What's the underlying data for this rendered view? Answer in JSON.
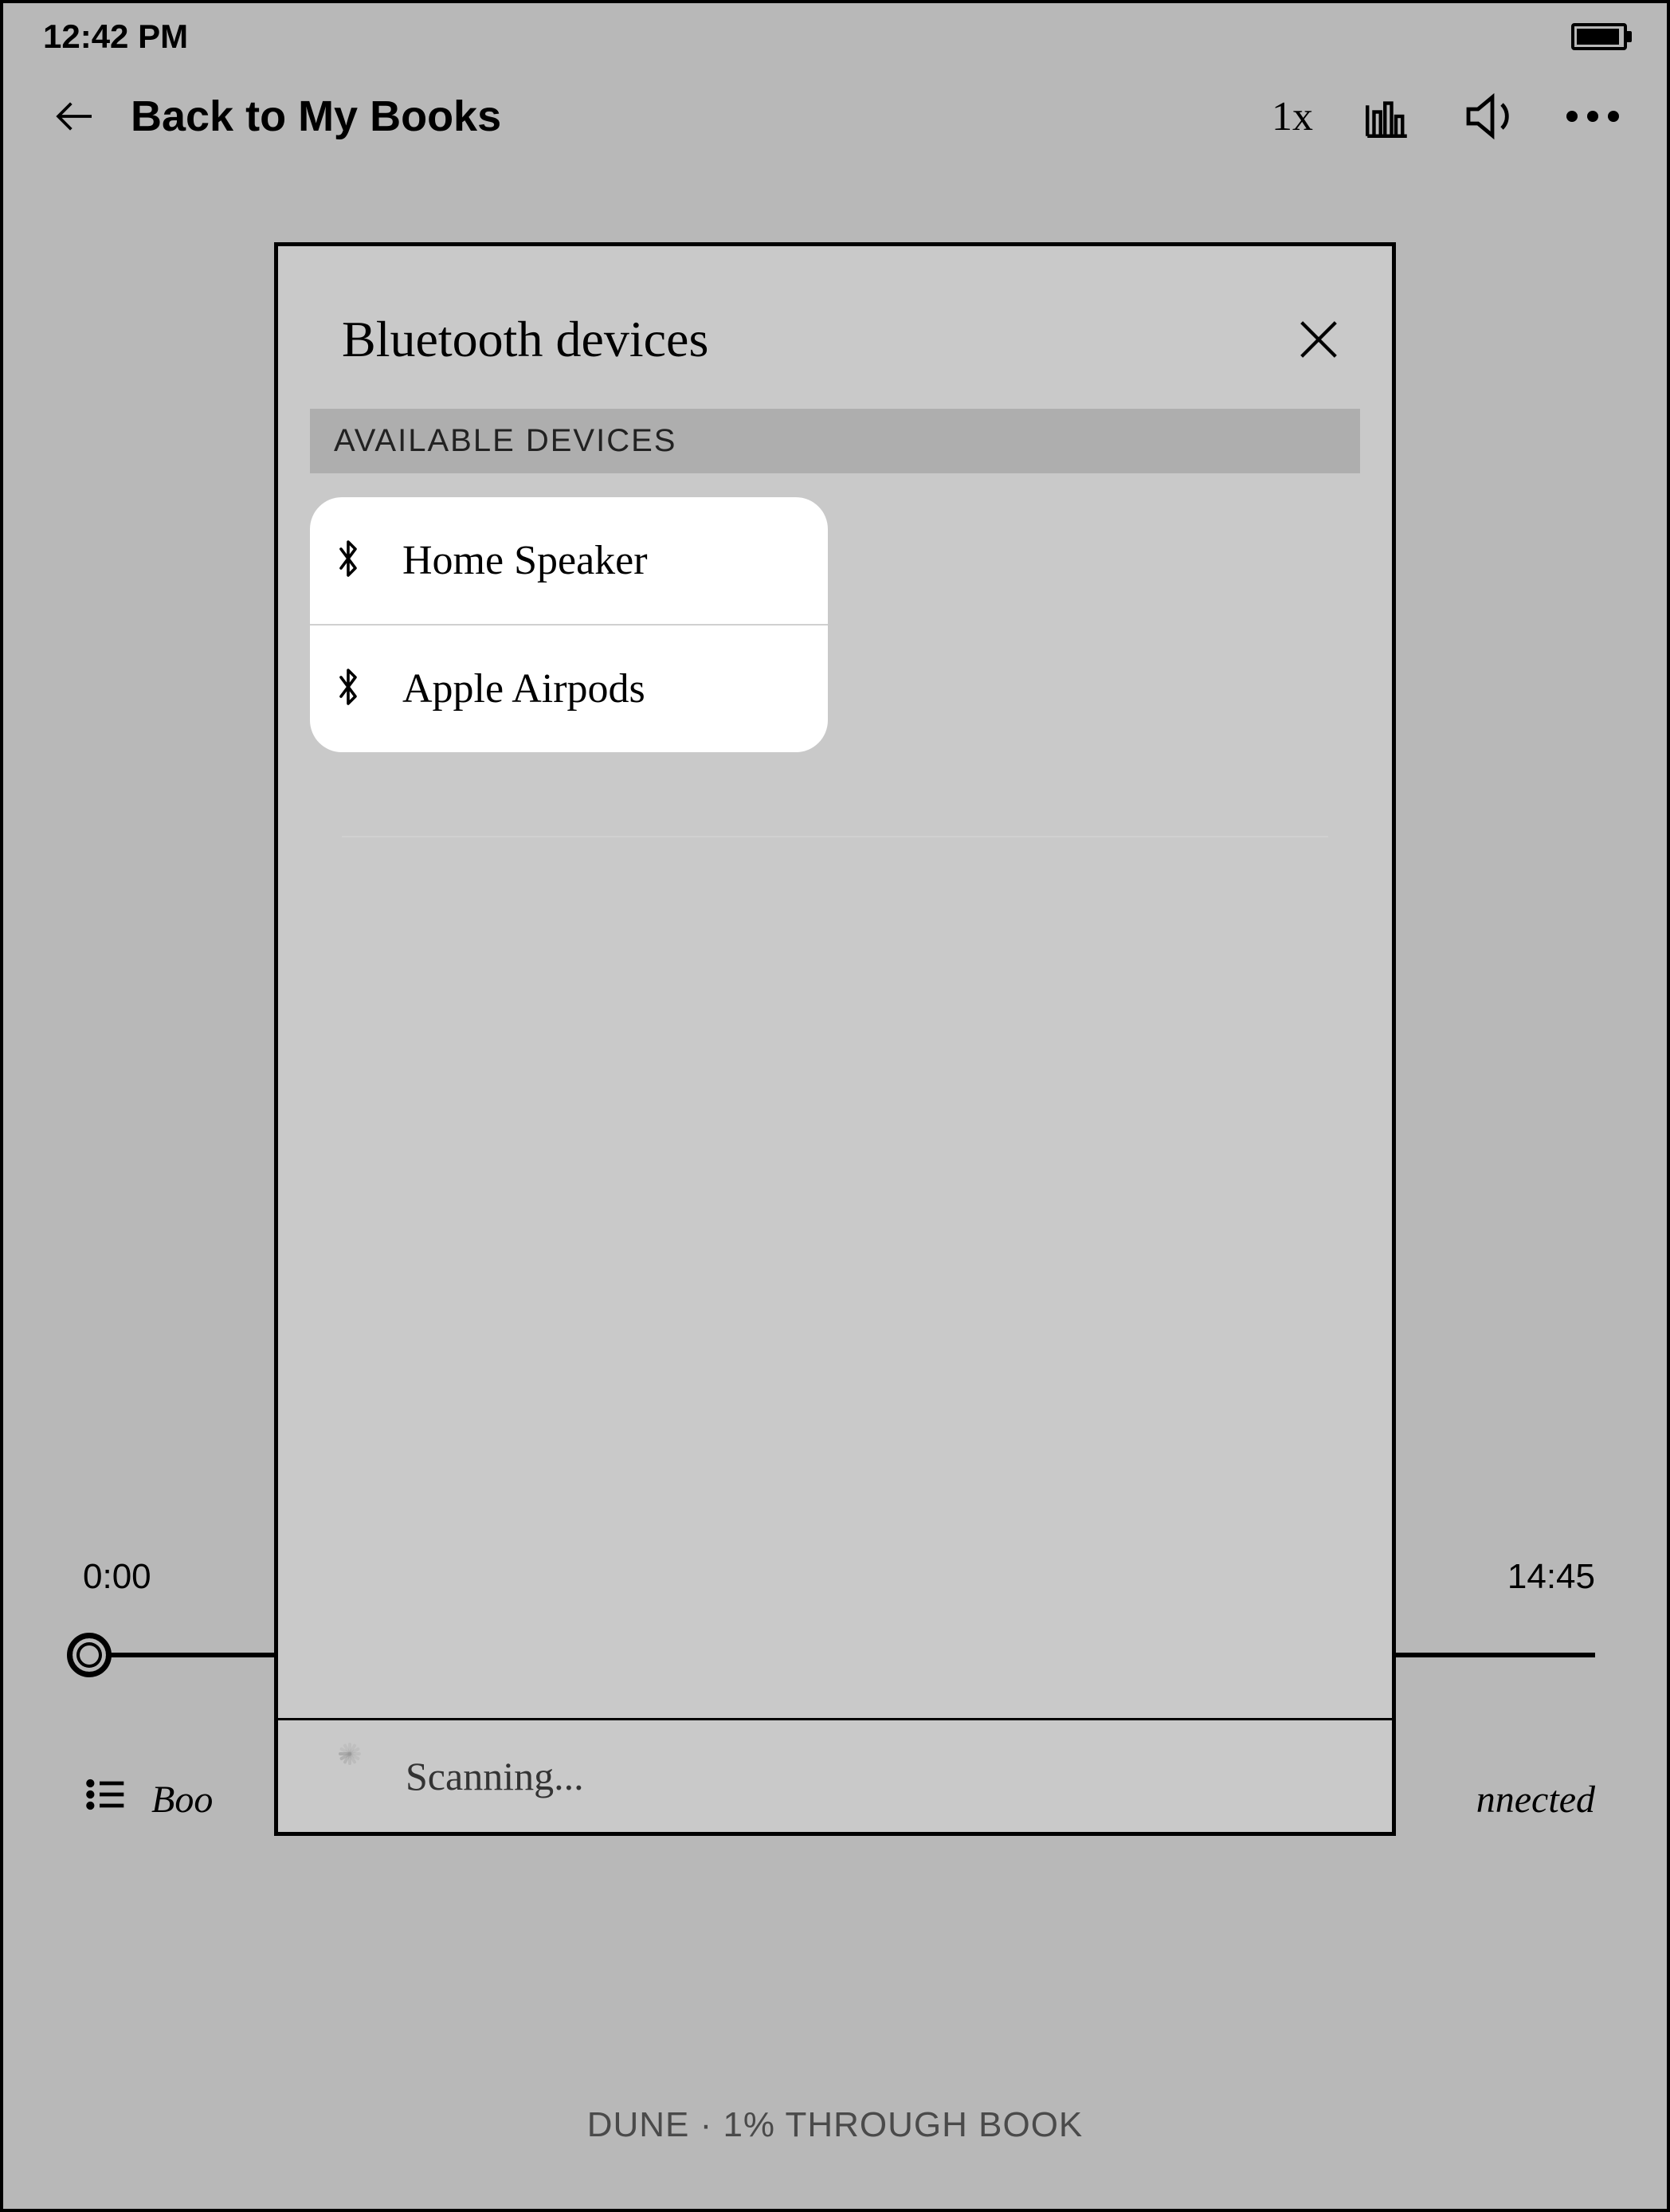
{
  "status": {
    "time": "12:42 PM"
  },
  "nav": {
    "back_label": "Back to My Books",
    "speed": "1x"
  },
  "player": {
    "elapsed": "0:00",
    "remaining": "14:45",
    "left_info_partial": "Boo",
    "right_info_partial": "nnected"
  },
  "dialog": {
    "title": "Bluetooth devices",
    "section": "AVAILABLE DEVICES",
    "devices": [
      {
        "name": "Home Speaker"
      },
      {
        "name": "Apple Airpods"
      }
    ],
    "footer_status": "Scanning..."
  },
  "footer": {
    "text": "DUNE · 1% THROUGH BOOK"
  }
}
